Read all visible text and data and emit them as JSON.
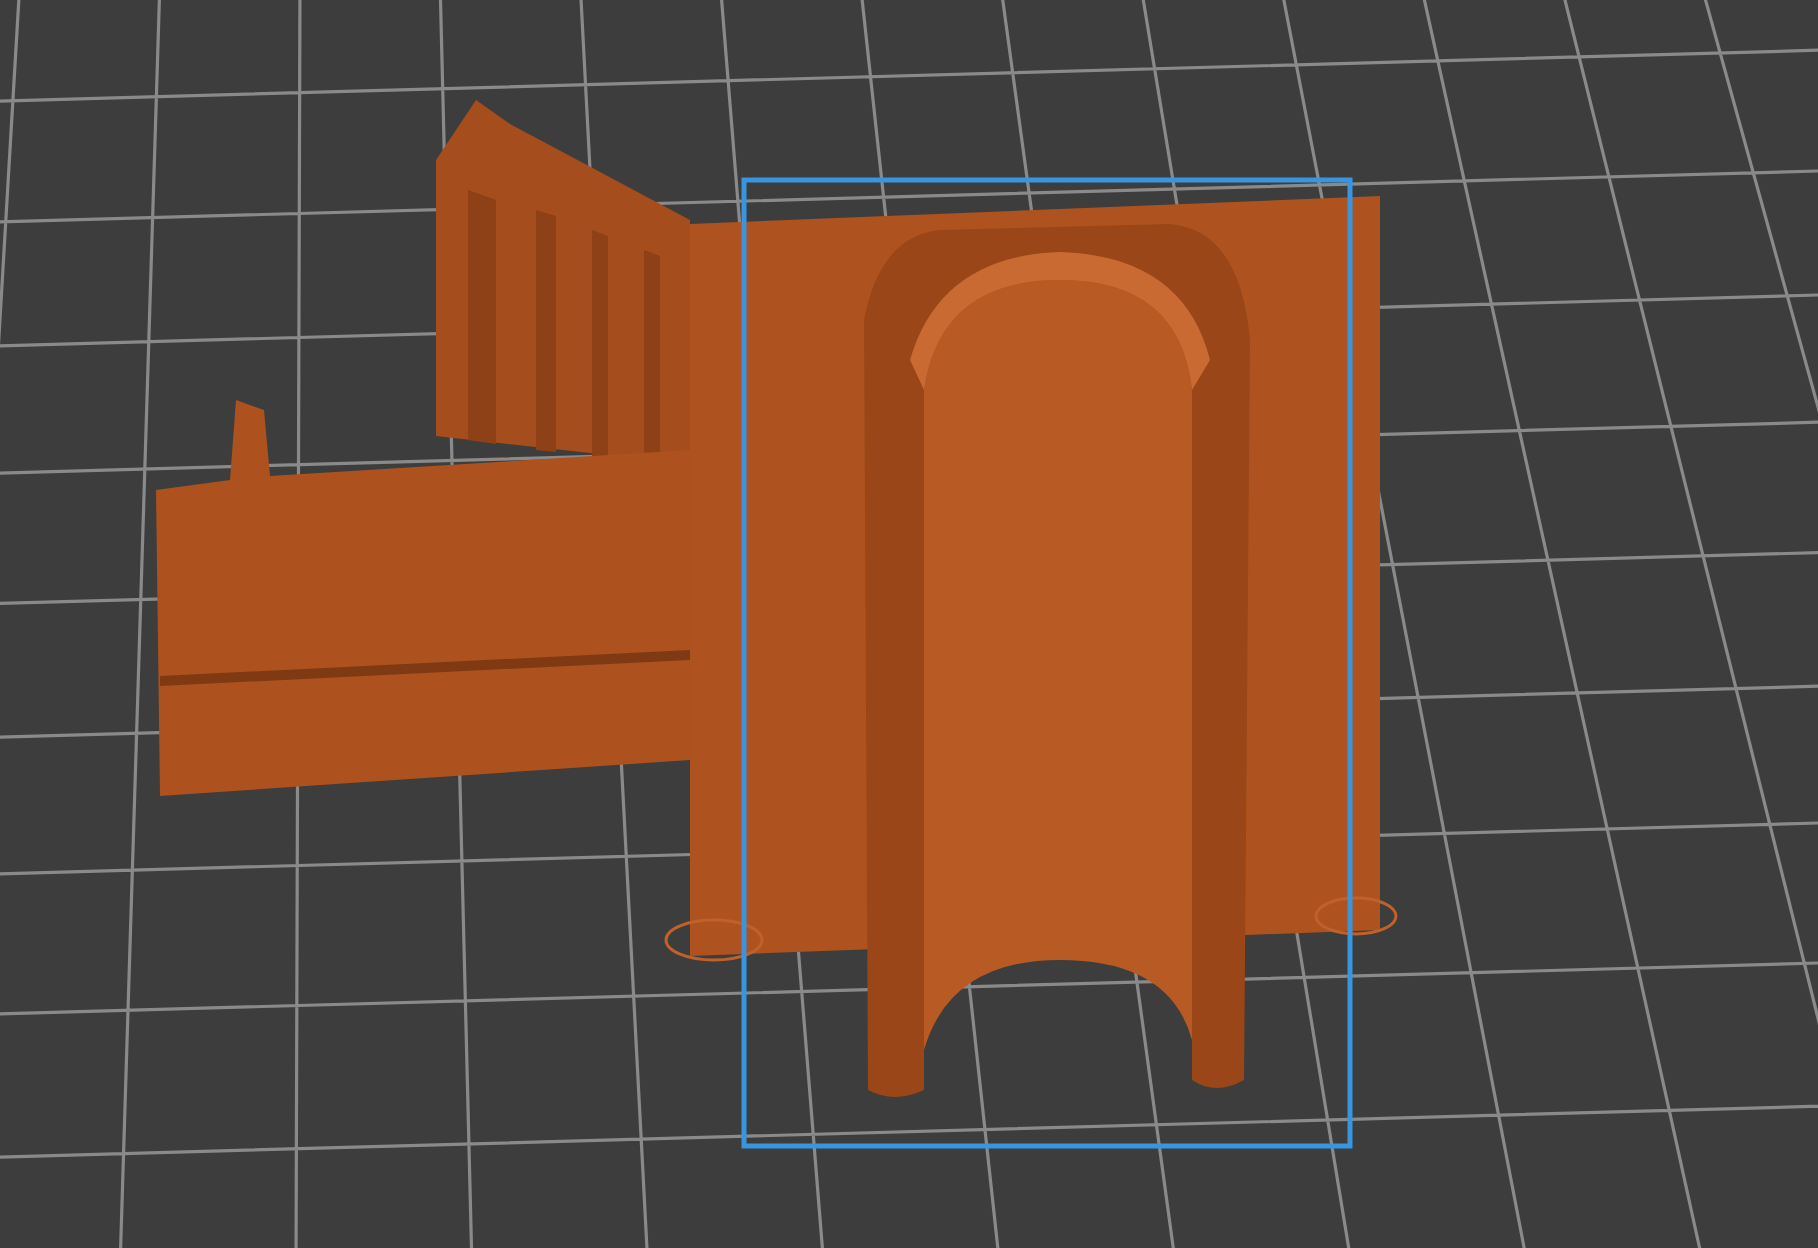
{
  "viewport": {
    "selected": true
  }
}
